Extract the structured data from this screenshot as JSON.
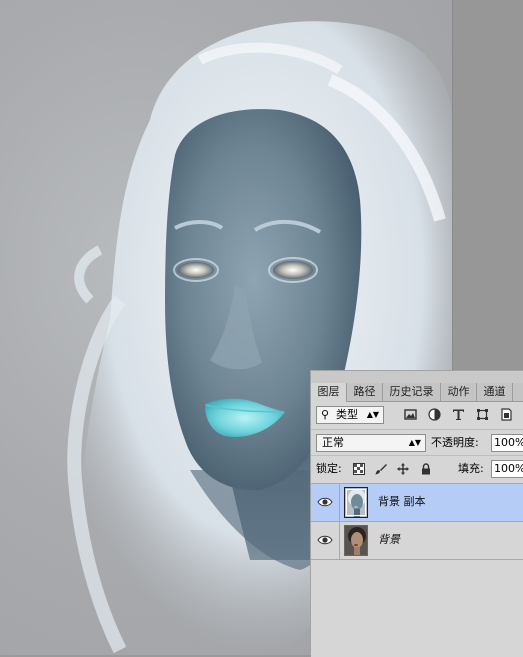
{
  "panel": {
    "tabs": [
      "图层",
      "路径",
      "历史记录",
      "动作",
      "通道"
    ],
    "active_tab": "图层",
    "filter": {
      "icon": "search-icon",
      "label": "类型"
    },
    "filter_icons": [
      "image-filter-icon",
      "adjustment-filter-icon",
      "type-filter-icon",
      "shape-filter-icon",
      "smart-object-filter-icon"
    ],
    "blend_mode": "正常",
    "opacity_label": "不透明度:",
    "opacity_value": "100%",
    "lock_label": "锁定:",
    "lock_icons": [
      "lock-transparent-icon",
      "lock-pixels-icon",
      "lock-position-icon",
      "lock-all-icon"
    ],
    "fill_label": "填充:",
    "fill_value": "100%",
    "layers": [
      {
        "name": "背景 副本",
        "selected": true,
        "visible": true
      },
      {
        "name": "背景",
        "selected": false,
        "visible": true,
        "italic": true
      }
    ]
  },
  "colors": {
    "panel_bg": "#d6d6d6",
    "selected_layer": "#b5cdf6",
    "canvas_bg": "#9a9a9a"
  }
}
